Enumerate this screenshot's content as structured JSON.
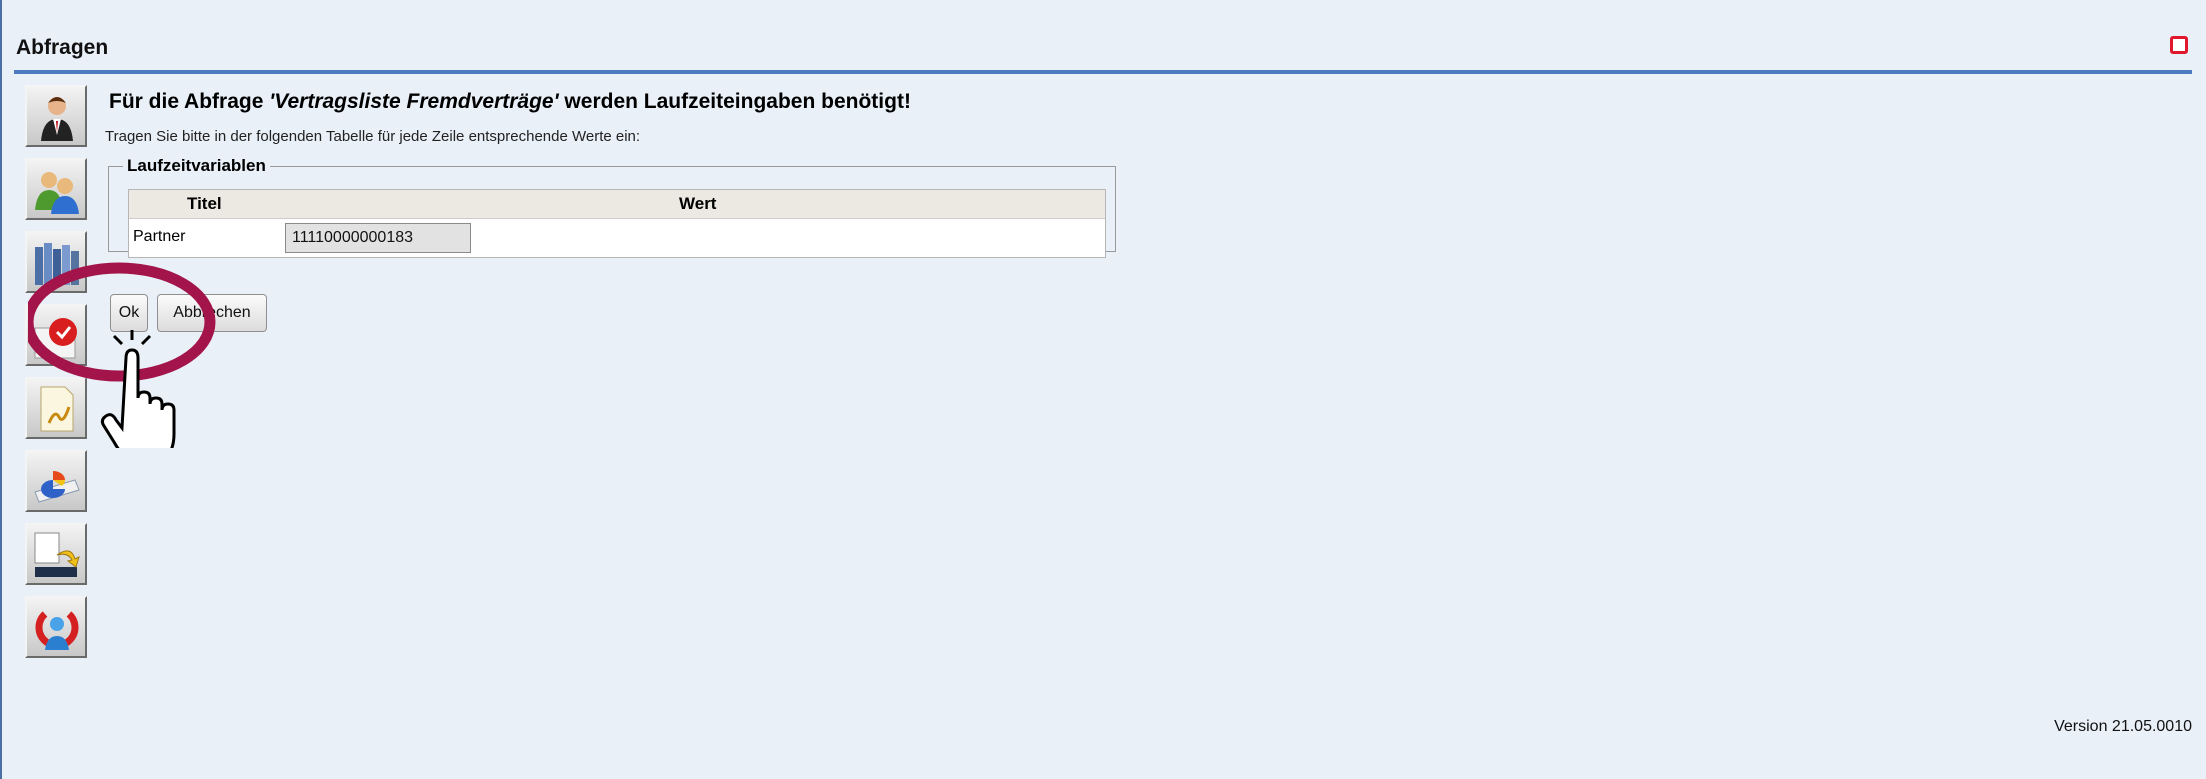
{
  "header": {
    "title": "Abfragen"
  },
  "icons": {
    "close": "close-icon",
    "nav": [
      "user-profile-icon",
      "users-group-icon",
      "contracts-library-icon",
      "calendar-icon",
      "document-signature-icon",
      "chart-report-icon",
      "document-export-icon",
      "logout-user-icon"
    ]
  },
  "dialog": {
    "heading_prefix": "Für die Abfrage ",
    "heading_query": "'Vertragsliste Fremdverträge'",
    "heading_suffix": " werden Laufzeiteingaben benötigt!",
    "instruction": "Tragen Sie bitte in der folgenden Tabelle für jede Zeile entsprechende Werte ein:",
    "fieldset_legend": "Laufzeitvariablen",
    "columns": [
      "Titel",
      "Wert"
    ],
    "rows": [
      {
        "title": "Partner",
        "value": "11110000000183"
      }
    ]
  },
  "buttons": {
    "ok": "Ok",
    "cancel": "Abbrechen"
  },
  "footer": {
    "version": "Version 21.05.0010"
  },
  "colors": {
    "accent": "#4a7bc0",
    "close": "#e0182d",
    "annotation": "#a3144a"
  }
}
